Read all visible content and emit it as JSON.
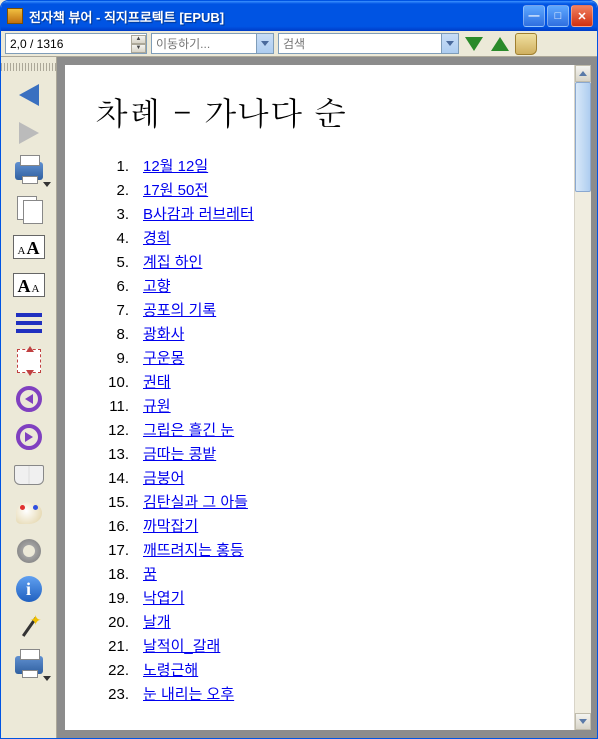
{
  "window": {
    "title": "전자책 뷰어 - 직지프로텍트 [EPUB]"
  },
  "toolbar": {
    "page_field": "2,0 / 1316",
    "nav_placeholder": "이동하기...",
    "search_placeholder": "검색"
  },
  "document": {
    "heading": "차례 - 가나다 순",
    "toc": [
      {
        "n": "1.",
        "t": "12월 12일"
      },
      {
        "n": "2.",
        "t": "17원 50전"
      },
      {
        "n": "3.",
        "t": "B사감과 러브레터"
      },
      {
        "n": "4.",
        "t": "경희"
      },
      {
        "n": "5.",
        "t": "계집 하인"
      },
      {
        "n": "6.",
        "t": "고향"
      },
      {
        "n": "7.",
        "t": "공포의 기록"
      },
      {
        "n": "8.",
        "t": "광화사"
      },
      {
        "n": "9.",
        "t": "구운몽"
      },
      {
        "n": "10.",
        "t": "권태"
      },
      {
        "n": "11.",
        "t": "규원"
      },
      {
        "n": "12.",
        "t": "그립은 흘긴 눈"
      },
      {
        "n": "13.",
        "t": "금따는 콩밭"
      },
      {
        "n": "14.",
        "t": "금붕어"
      },
      {
        "n": "15.",
        "t": "김탄실과 그 아들"
      },
      {
        "n": "16.",
        "t": "까막잡기"
      },
      {
        "n": "17.",
        "t": "깨뜨려지는 홍등"
      },
      {
        "n": "18.",
        "t": "꿈"
      },
      {
        "n": "19.",
        "t": "낙엽기"
      },
      {
        "n": "20.",
        "t": "날개"
      },
      {
        "n": "21.",
        "t": "날적이_갈래"
      },
      {
        "n": "22.",
        "t": "노령근해"
      },
      {
        "n": "23.",
        "t": "눈 내리는 오후"
      }
    ]
  }
}
